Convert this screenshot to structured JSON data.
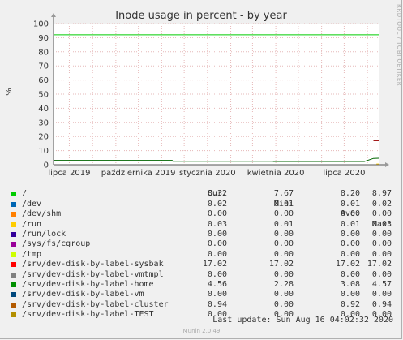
{
  "chart_data": {
    "type": "line",
    "title": "Inode usage in percent - by year",
    "ylabel": "%",
    "ylim": [
      0,
      100
    ],
    "y_ticks": [
      "0",
      "10",
      "20",
      "30",
      "40",
      "50",
      "60",
      "70",
      "80",
      "90",
      "100"
    ],
    "x_range": [
      "2019-06-10",
      "2020-08-16"
    ],
    "x_ticks": [
      {
        "date": "2019-07-01",
        "label": "lipca 2019"
      },
      {
        "date": "2019-10-01",
        "label": "października 2019"
      },
      {
        "date": "2020-01-01",
        "label": "stycznia 2020"
      },
      {
        "date": "2020-04-01",
        "label": "kwietnia 2020"
      },
      {
        "date": "2020-07-01",
        "label": "lipca 2020"
      }
    ],
    "grid": true,
    "series": [
      {
        "name": "/",
        "color": "#00cc00",
        "points": [
          [
            "2019-06-10",
            92.0
          ],
          [
            "2020-08-16",
            92.0
          ]
        ]
      },
      {
        "name": "/srv/dev-disk-by-label-sysbak",
        "color": "#990000",
        "points": [
          [
            "2020-08-09",
            17.02
          ],
          [
            "2020-08-16",
            17.02
          ]
        ]
      },
      {
        "name": "/srv/dev-disk-by-label-home",
        "color": "#006600",
        "points": [
          [
            "2019-06-10",
            3.1
          ],
          [
            "2019-11-15",
            3.1
          ],
          [
            "2019-11-16",
            2.4
          ],
          [
            "2020-03-28",
            2.4
          ],
          [
            "2020-03-29",
            2.3
          ],
          [
            "2020-07-28",
            2.3
          ],
          [
            "2020-08-09",
            4.5
          ],
          [
            "2020-08-16",
            4.57
          ]
        ]
      },
      {
        "name": "/srv/dev-disk-by-label-TEST",
        "color": "#ffcc00",
        "points": [
          [
            "2020-08-13",
            0.5
          ],
          [
            "2020-08-16",
            0.5
          ]
        ]
      }
    ]
  },
  "legend": {
    "headers": [
      "Cur:",
      "Min:",
      "Avg:",
      "Max:"
    ],
    "rows": [
      {
        "name": "/",
        "color": "#00cc00",
        "cur": "8.32",
        "min": "7.67",
        "avg": "8.20",
        "max": "8.97"
      },
      {
        "name": "/dev",
        "color": "#0066b3",
        "cur": "0.02",
        "min": "0.01",
        "avg": "0.01",
        "max": "0.02"
      },
      {
        "name": "/dev/shm",
        "color": "#ff8000",
        "cur": "0.00",
        "min": "0.00",
        "avg": "0.00",
        "max": "0.00"
      },
      {
        "name": "/run",
        "color": "#ffcc00",
        "cur": "0.03",
        "min": "0.01",
        "avg": "0.01",
        "max": "0.03"
      },
      {
        "name": "/run/lock",
        "color": "#330099",
        "cur": "0.00",
        "min": "0.00",
        "avg": "0.00",
        "max": "0.00"
      },
      {
        "name": "/sys/fs/cgroup",
        "color": "#990099",
        "cur": "0.00",
        "min": "0.00",
        "avg": "0.00",
        "max": "0.00"
      },
      {
        "name": "/tmp",
        "color": "#ccff00",
        "cur": "0.00",
        "min": "0.00",
        "avg": "0.00",
        "max": "0.00"
      },
      {
        "name": "/srv/dev-disk-by-label-sysbak",
        "color": "#ff0000",
        "cur": "17.02",
        "min": "17.02",
        "avg": "17.02",
        "max": "17.02"
      },
      {
        "name": "/srv/dev-disk-by-label-vmtmpl",
        "color": "#808080",
        "cur": "0.00",
        "min": "0.00",
        "avg": "0.00",
        "max": "0.00"
      },
      {
        "name": "/srv/dev-disk-by-label-home",
        "color": "#008f00",
        "cur": "4.56",
        "min": "2.28",
        "avg": "3.08",
        "max": "4.57"
      },
      {
        "name": "/srv/dev-disk-by-label-vm",
        "color": "#00487d",
        "cur": "0.00",
        "min": "0.00",
        "avg": "0.00",
        "max": "0.00"
      },
      {
        "name": "/srv/dev-disk-by-label-cluster",
        "color": "#b35a00",
        "cur": "0.94",
        "min": "0.00",
        "avg": "0.92",
        "max": "0.94"
      },
      {
        "name": "/srv/dev-disk-by-label-TEST",
        "color": "#b38f00",
        "cur": "0.00",
        "min": "0.00",
        "avg": "0.00",
        "max": "0.00"
      }
    ]
  },
  "footer": {
    "last_update": "Last update: Sun Aug 16 04:02:32 2020",
    "version": "Munin 2.0.49"
  },
  "side_label": "RRDTOOL / TOBI OETIKER"
}
